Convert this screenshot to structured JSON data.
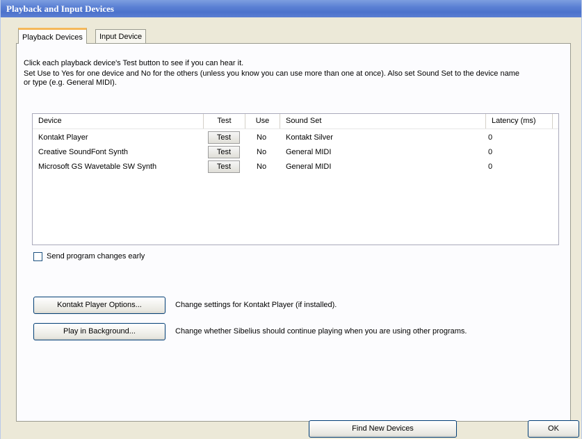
{
  "window": {
    "title": "Playback and Input Devices"
  },
  "tabs": [
    {
      "label": "Playback Devices",
      "active": true
    },
    {
      "label": "Input Device",
      "active": false
    }
  ],
  "instructions": {
    "line1": "Click each playback device's Test button to see if you can hear it.",
    "line2": "Set Use to Yes for one device and No for the others (unless you know you can use more than one at once). Also set Sound Set to the device name",
    "line3": "or type (e.g. General MIDI)."
  },
  "devices_table": {
    "columns": [
      "Device",
      "Test",
      "Use",
      "Sound Set",
      "Latency (ms)"
    ],
    "rows": [
      {
        "device": "Kontakt Player",
        "test": "Test",
        "use": "No",
        "sound_set": "Kontakt Silver",
        "latency": "0"
      },
      {
        "device": "Creative SoundFont Synth",
        "test": "Test",
        "use": "No",
        "sound_set": "General MIDI",
        "latency": "0"
      },
      {
        "device": "Microsoft GS Wavetable SW Synth",
        "test": "Test",
        "use": "No",
        "sound_set": "General MIDI",
        "latency": "0"
      }
    ]
  },
  "send_program_changes": {
    "label": "Send program changes early",
    "checked": false
  },
  "kontakt_options": {
    "button_label": "Kontakt Player Options...",
    "description": "Change settings for Kontakt Player (if installed)."
  },
  "play_background": {
    "button_label": "Play in Background...",
    "description": "Change whether Sibelius should continue playing when you are using other programs."
  },
  "footer": {
    "find_devices_label": "Find New Devices",
    "ok_label": "OK"
  }
}
